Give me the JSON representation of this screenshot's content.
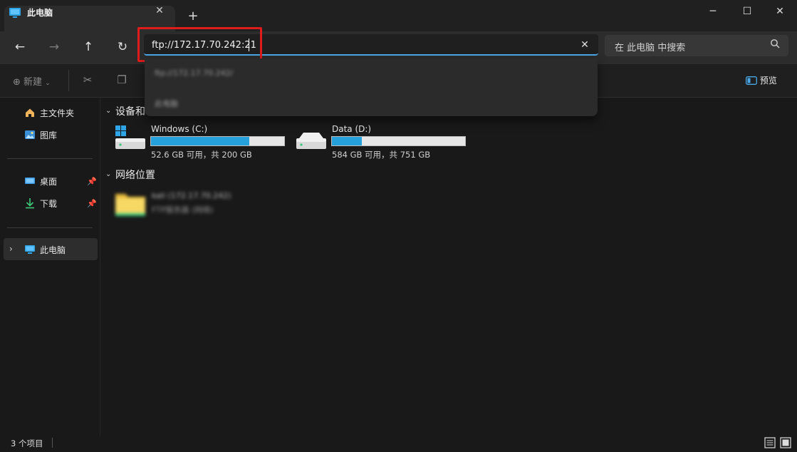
{
  "window": {
    "tab_title": "此电脑",
    "new_tab_icon": "plus-icon",
    "minimize_icon": "minimize-icon",
    "maximize_icon": "maximize-icon",
    "close_icon": "close-icon"
  },
  "nav": {
    "address_value": "ftp://172.17.70.242:21",
    "search_placeholder": "在 此电脑 中搜索"
  },
  "address_dropdown": {
    "items": [
      "ftp://172.17.70.242/",
      "此电脑"
    ]
  },
  "command_bar": {
    "new_label": "新建",
    "preview_label": "预览"
  },
  "sidebar": {
    "quick": [
      {
        "label": "主文件夹",
        "icon": "home-icon"
      },
      {
        "label": "图库",
        "icon": "gallery-icon"
      }
    ],
    "pinned": [
      {
        "label": "桌面",
        "icon": "desktop-icon",
        "pinned": true
      },
      {
        "label": "下载",
        "icon": "download-icon",
        "pinned": true
      }
    ],
    "this_pc": {
      "label": "此电脑",
      "icon": "pc-icon",
      "selected": true
    }
  },
  "main": {
    "devices_header": "设备和",
    "drives": [
      {
        "name": "Windows (C:)",
        "info": "52.6 GB 可用，共 200 GB",
        "used_fraction": 0.737
      },
      {
        "name": "Data (D:)",
        "info": "584 GB 可用，共 751 GB",
        "used_fraction": 0.222
      }
    ],
    "network_header": "网络位置",
    "network_items": [
      {
        "name": "kali (172.17.70.242)",
        "sub": "FTP服务器 (网络)"
      }
    ]
  },
  "status": {
    "item_count": "3 个项目"
  },
  "colors": {
    "accent": "#26a0da",
    "highlight_box": "#e01b1b",
    "background": "#191919"
  }
}
